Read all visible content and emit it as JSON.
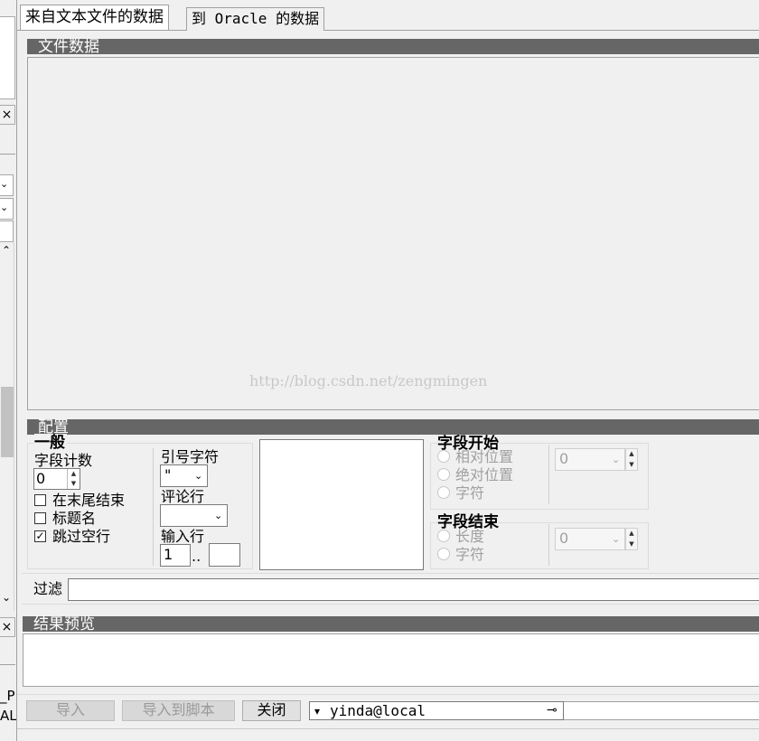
{
  "left_panel": {
    "close_glyph": "×",
    "chevron_down": "⌄",
    "scroll_up": "⌃",
    "scroll_down": "⌄",
    "bottom_text_1": "_P",
    "bottom_text_2": "AL"
  },
  "tabs": [
    {
      "label": "来自文本文件的数据",
      "active": true
    },
    {
      "label": "到 Oracle 的数据",
      "active": false
    }
  ],
  "file_data": {
    "header": "文件数据",
    "watermark": "http://blog.csdn.net/zengmingen"
  },
  "config": {
    "header": "配置",
    "general": {
      "title": "一般",
      "field_count_label": "字段计数",
      "field_count_value": "0",
      "end_at_tail_label": "在末尾结束",
      "end_at_tail_checked": false,
      "title_name_label": "标题名",
      "title_name_checked": false,
      "skip_blank_label": "跳过空行",
      "skip_blank_checked": true,
      "quote_label": "引号字符",
      "quote_value": "\"",
      "comment_label": "评论行",
      "comment_value": "",
      "input_rows_label": "输入行",
      "input_from": "1",
      "range_sep": "..",
      "input_to": ""
    },
    "field_start": {
      "title": "字段开始",
      "options": [
        "相对位置",
        "绝对位置",
        "字符"
      ],
      "value": "0"
    },
    "field_end": {
      "title": "字段结束",
      "options": [
        "长度",
        "字符"
      ],
      "value": "0"
    }
  },
  "filter": {
    "label": "过滤",
    "value": ""
  },
  "result_preview": {
    "header": "结果预览"
  },
  "bottom": {
    "import_label": "导入",
    "import_script_label": "导入到脚本",
    "close_label": "关闭",
    "connection": "yinda@local",
    "connection_arrow": "▾",
    "pin_glyph": "⊸"
  }
}
